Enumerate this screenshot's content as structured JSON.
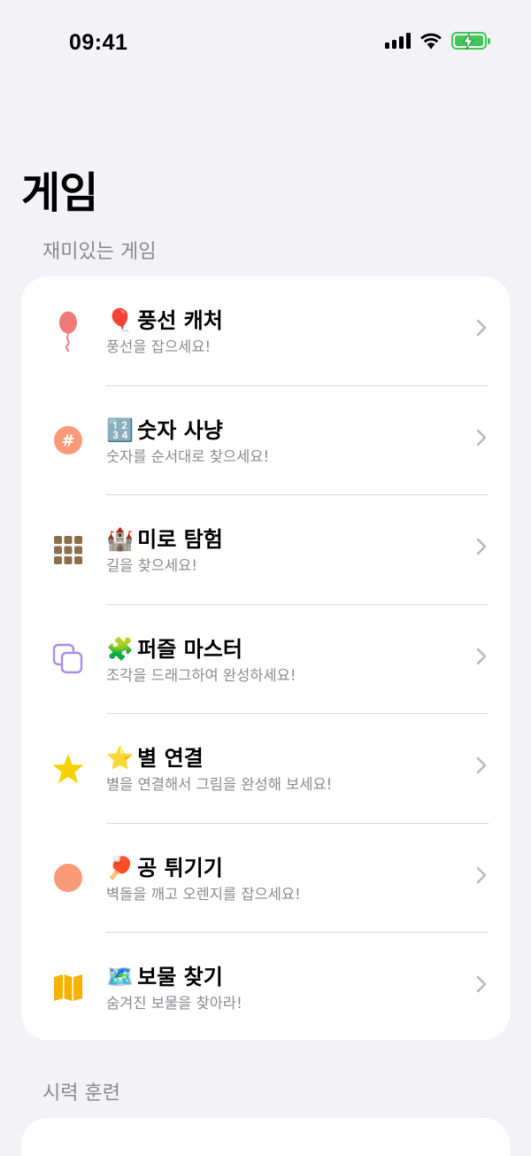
{
  "status_bar": {
    "time": "09:41"
  },
  "page": {
    "title": "게임"
  },
  "sections": [
    {
      "header": "재미있는 게임",
      "items": [
        {
          "emoji": "🎈",
          "title": "풍선 캐처",
          "subtitle": "풍선을 잡으세요!",
          "icon": "balloon-icon",
          "color": "#f07a7a"
        },
        {
          "emoji": "🔢",
          "title": "숫자 사냥",
          "subtitle": "숫자를 순서대로 찾으세요!",
          "icon": "number-hash-icon",
          "color": "#f99a78"
        },
        {
          "emoji": "🏰",
          "title": "미로 탐험",
          "subtitle": "길을 찾으세요!",
          "icon": "grid-icon",
          "color": "#8a6f4a"
        },
        {
          "emoji": "🧩",
          "title": "퍼즐 마스터",
          "subtitle": "조각을 드래그하여 완성하세요!",
          "icon": "squares-stack-icon",
          "color": "#a98ee6"
        },
        {
          "emoji": "⭐",
          "title": "별 연결",
          "subtitle": "별을 연결해서 그림을 완성해 보세요!",
          "icon": "star-icon",
          "color": "#f5d200"
        },
        {
          "emoji": "🏓",
          "title": "공 튀기기",
          "subtitle": "벽돌을 깨고 오렌지를 잡으세요!",
          "icon": "circle-icon",
          "color": "#f99a78"
        },
        {
          "emoji": "🗺️",
          "title": "보물 찾기",
          "subtitle": "숨겨진 보물을 찾아라!",
          "icon": "map-icon",
          "color": "#f5b300"
        }
      ]
    },
    {
      "header": "시력 훈련",
      "items": []
    }
  ]
}
